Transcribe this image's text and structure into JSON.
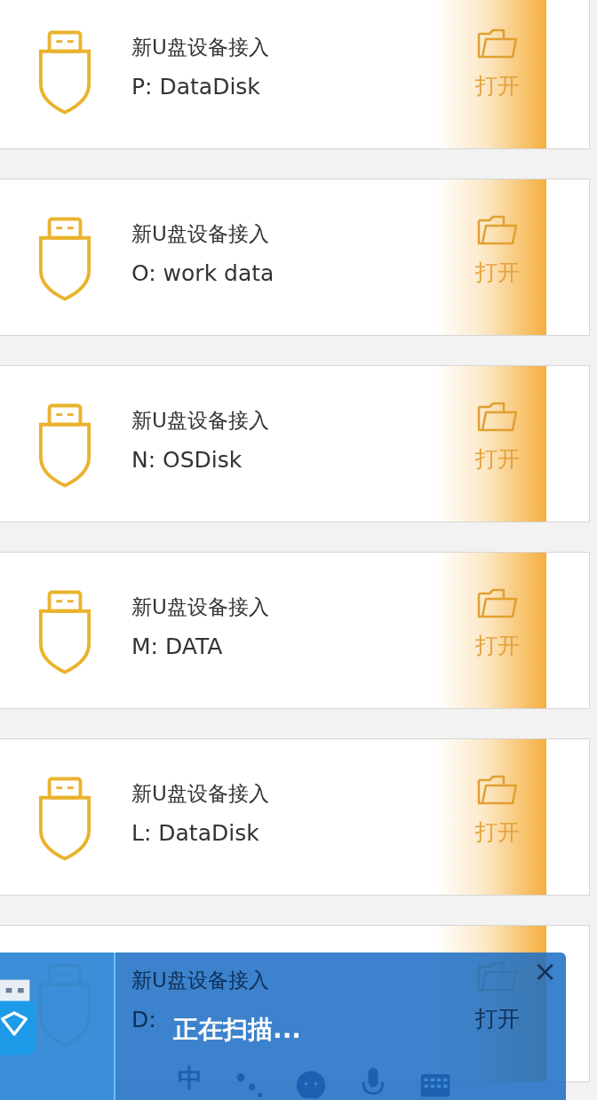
{
  "devices": [
    {
      "title": "新U盘设备接入",
      "drive": "P: DataDisk",
      "action": "打开"
    },
    {
      "title": "新U盘设备接入",
      "drive": "O: work data",
      "action": "打开"
    },
    {
      "title": "新U盘设备接入",
      "drive": "N: OSDisk",
      "action": "打开"
    },
    {
      "title": "新U盘设备接入",
      "drive": "M: DATA",
      "action": "打开"
    },
    {
      "title": "新U盘设备接入",
      "drive": "L: DataDisk",
      "action": "打开"
    },
    {
      "title": "新U盘设备接入",
      "drive": "D:",
      "action": "打开"
    }
  ],
  "scan_popup": {
    "status": "正在扫描...",
    "close": "×"
  },
  "ime_toolbar": {
    "items": [
      {
        "kind": "text",
        "label": "中"
      },
      {
        "kind": "dots"
      },
      {
        "kind": "face"
      },
      {
        "kind": "mic"
      },
      {
        "kind": "keyboard"
      }
    ]
  }
}
